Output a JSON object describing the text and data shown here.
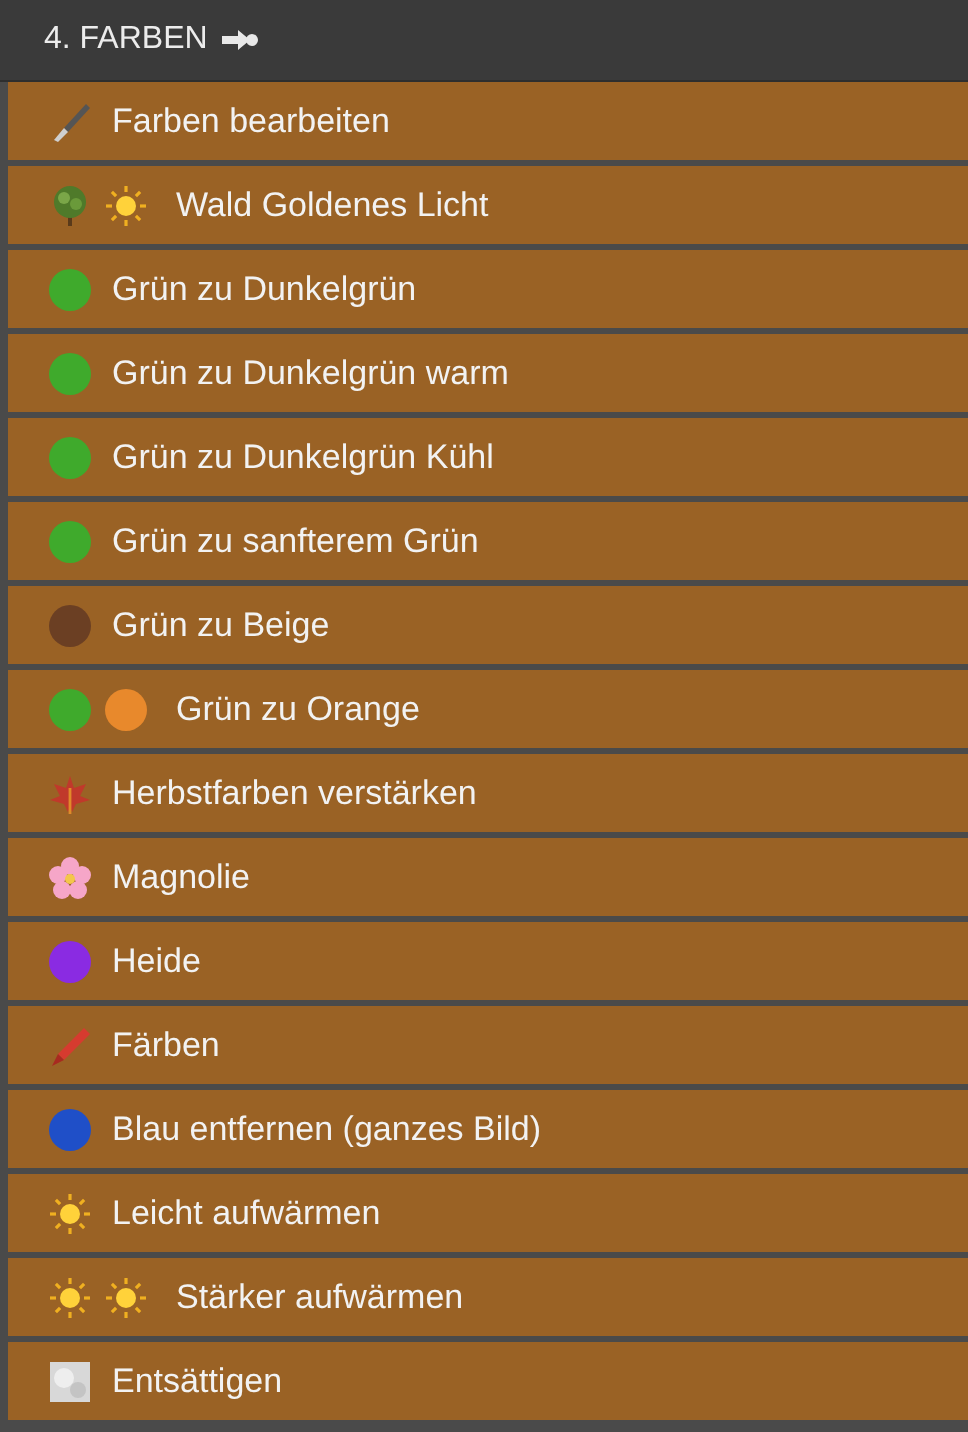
{
  "header": {
    "title": "4. FARBEN"
  },
  "items": [
    {
      "label": "Farben bearbeiten",
      "icons": [
        {
          "kind": "brush"
        }
      ]
    },
    {
      "label": "Wald Goldenes Licht",
      "icons": [
        {
          "kind": "tree"
        },
        {
          "kind": "sun"
        }
      ]
    },
    {
      "label": "Grün zu Dunkelgrün",
      "icons": [
        {
          "kind": "dot",
          "color": "#3faa2c"
        }
      ]
    },
    {
      "label": "Grün zu Dunkelgrün warm",
      "icons": [
        {
          "kind": "dot",
          "color": "#3faa2c"
        }
      ]
    },
    {
      "label": "Grün zu Dunkelgrün Kühl",
      "icons": [
        {
          "kind": "dot",
          "color": "#3faa2c"
        }
      ]
    },
    {
      "label": "Grün zu sanfterem Grün",
      "icons": [
        {
          "kind": "dot",
          "color": "#3faa2c"
        }
      ]
    },
    {
      "label": "Grün zu Beige",
      "icons": [
        {
          "kind": "dot",
          "color": "#6b3f23"
        }
      ]
    },
    {
      "label": "Grün zu Orange",
      "icons": [
        {
          "kind": "dot",
          "color": "#3faa2c"
        },
        {
          "kind": "dot",
          "color": "#e8892c"
        }
      ]
    },
    {
      "label": "Herbstfarben verstärken",
      "icons": [
        {
          "kind": "leaf"
        }
      ]
    },
    {
      "label": "Magnolie",
      "icons": [
        {
          "kind": "flower"
        }
      ]
    },
    {
      "label": "Heide",
      "icons": [
        {
          "kind": "dot",
          "color": "#8a2be2"
        }
      ]
    },
    {
      "label": "Färben",
      "icons": [
        {
          "kind": "crayon"
        }
      ]
    },
    {
      "label": "Blau entfernen (ganzes Bild)",
      "icons": [
        {
          "kind": "dot",
          "color": "#1f4fc8"
        }
      ]
    },
    {
      "label": "Leicht aufwärmen",
      "icons": [
        {
          "kind": "sun"
        }
      ]
    },
    {
      "label": "Stärker aufwärmen",
      "icons": [
        {
          "kind": "sun"
        },
        {
          "kind": "sun"
        }
      ]
    },
    {
      "label": "Entsättigen",
      "icons": [
        {
          "kind": "grey"
        }
      ]
    }
  ]
}
